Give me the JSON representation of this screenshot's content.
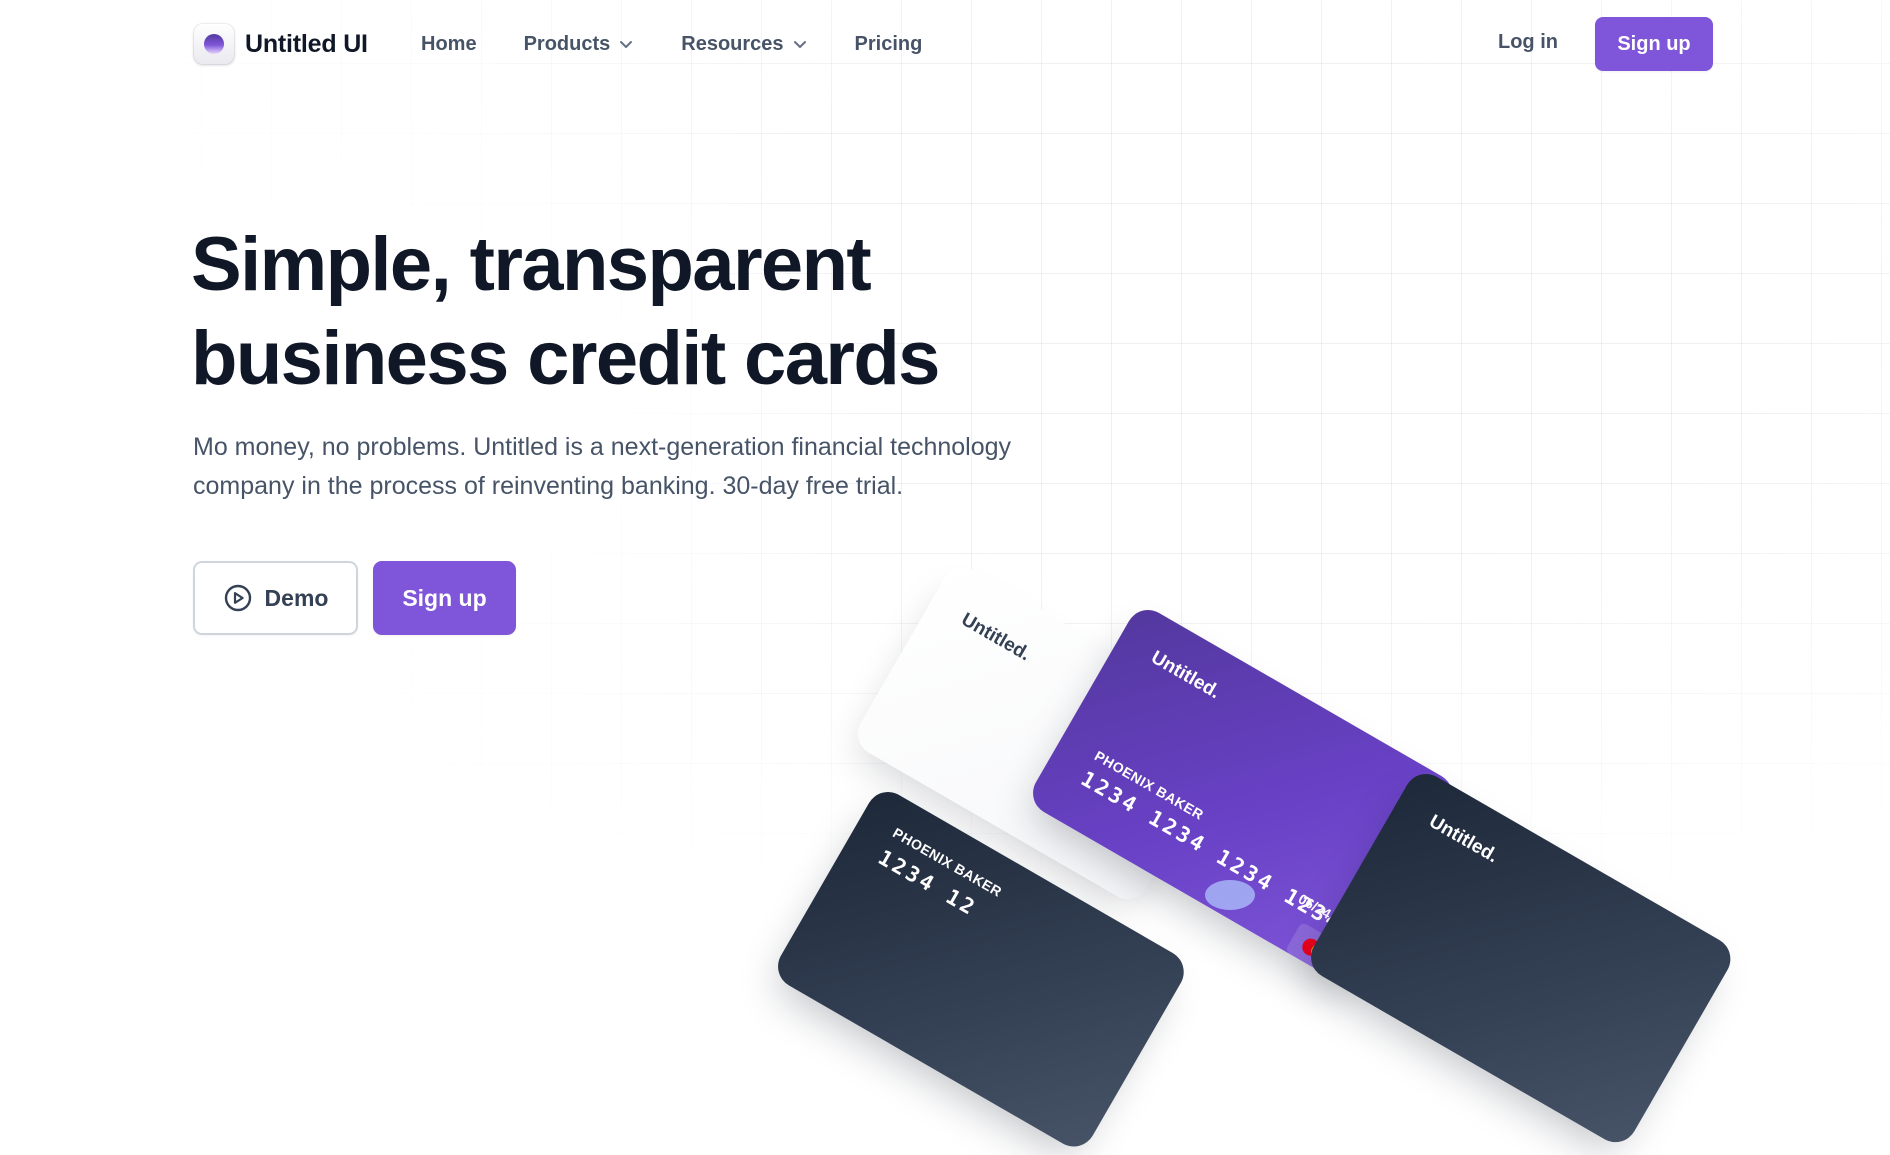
{
  "brand": {
    "name": "Untitled UI"
  },
  "nav": {
    "items": [
      {
        "label": "Home",
        "dropdown": false
      },
      {
        "label": "Products",
        "dropdown": true
      },
      {
        "label": "Resources",
        "dropdown": true
      },
      {
        "label": "Pricing",
        "dropdown": false
      }
    ],
    "login_label": "Log in",
    "signup_label": "Sign up"
  },
  "hero": {
    "title_line1": "Simple, transparent",
    "title_line2": "business credit cards",
    "subtitle": "Mo money, no problems. Untitled is a next-generation financial technology company in the process of reinventing banking. 30-day free trial.",
    "demo_label": "Demo",
    "signup_label": "Sign up"
  },
  "cards": {
    "white": {
      "brand": "Untitled."
    },
    "dark_left": {
      "holder": "PHOENIX BAKER",
      "number": "1234 12"
    },
    "purple": {
      "brand": "Untitled.",
      "holder": "PHOENIX BAKER",
      "number": "1234 1234 1234 1234",
      "expiry": "06/24"
    },
    "dark_right": {
      "brand": "Untitled."
    }
  },
  "colors": {
    "primary": "#7f56d9",
    "heading": "#101828",
    "body_text": "#475467",
    "card_purple": "#6941c6",
    "card_dark": "#1d2939"
  },
  "icons": {
    "dropdown": "chevron-down-icon",
    "demo": "play-circle-icon",
    "contactless": "contactless-icon",
    "network": "mastercard-icon"
  }
}
